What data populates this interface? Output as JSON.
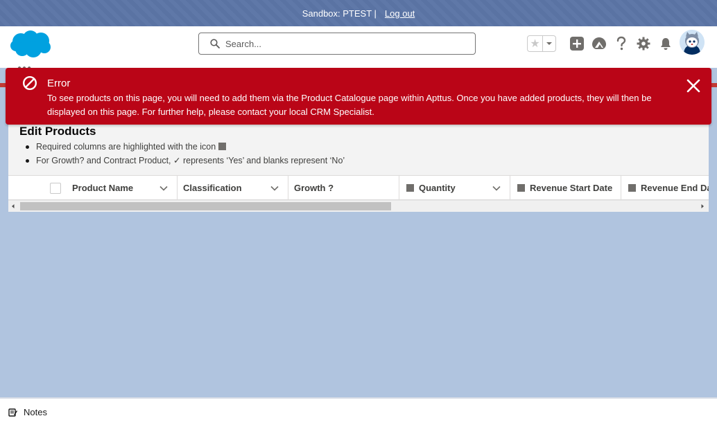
{
  "sandbox": {
    "label": "Sandbox: PTEST |",
    "logout": "Log out"
  },
  "header": {
    "search_placeholder": "Search...",
    "icons": [
      "salesforce-cloud-logo",
      "favorites-star-icon",
      "chevron-down-icon",
      "global-actions-plus-icon",
      "trailhead-icon",
      "help-icon",
      "gear-icon",
      "bell-icon",
      "avatar"
    ]
  },
  "toast": {
    "title": "Error",
    "message": "To see products on this page, you will need to add them via the Product Catalogue page within Apttus. Once you have added products, they will then be displayed on this page. For further help, please contact your local CRM Specialist."
  },
  "card": {
    "title": "Edit Products",
    "notes": [
      "Required columns are highlighted with the icon",
      "For Growth? and Contract Product, ✓ represents ‘Yes’ and blanks represent ‘No’"
    ]
  },
  "table": {
    "columns": [
      {
        "label": "Product Name",
        "required": false,
        "sortable": true
      },
      {
        "label": "Classification",
        "required": false,
        "sortable": true
      },
      {
        "label": "Growth ?",
        "required": false,
        "sortable": false
      },
      {
        "label": "Quantity",
        "required": true,
        "sortable": true
      },
      {
        "label": "Revenue Start Date",
        "required": true,
        "sortable": false
      },
      {
        "label": "Revenue End Da",
        "required": true,
        "sortable": false
      }
    ]
  },
  "utility": {
    "notes_label": "Notes"
  },
  "colors": {
    "sandbox_bar": "#5a73a3",
    "error_red": "#ba0517",
    "page_bg": "#b0c4df",
    "brand_blue": "#00a1e0"
  }
}
